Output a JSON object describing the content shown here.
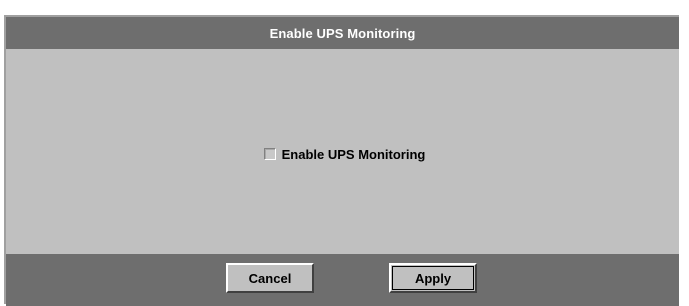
{
  "dialog": {
    "title": "Enable UPS Monitoring"
  },
  "content": {
    "checkbox_label": "Enable UPS Monitoring",
    "checkbox_checked": false
  },
  "buttons": {
    "cancel_label": "Cancel",
    "apply_label": "Apply"
  },
  "colors": {
    "title_bar": "#6e6e6e",
    "panel": "#c0c0c0",
    "title_text": "#ffffff"
  }
}
